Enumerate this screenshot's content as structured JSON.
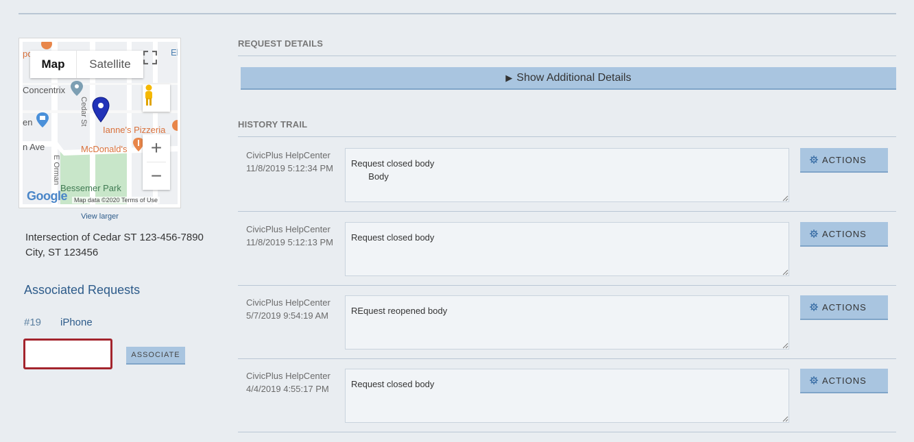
{
  "map": {
    "type_map": "Map",
    "type_satellite": "Satellite",
    "labels": {
      "concentrix": "Concentrix",
      "cedar_st": "Cedar St",
      "pizzeria": "Ianne's Pizzeria",
      "mcdonalds": "McDonald's",
      "park": "Bessemer Park",
      "orman": "E Orman",
      "ave": "n Ave",
      "en": "en",
      "po": "po",
      "el": "El"
    },
    "google": "Google",
    "attribution": "Map data ©2020  Terms of Use",
    "zoom_in": "+",
    "zoom_out": "−",
    "view_larger": "View larger"
  },
  "address": {
    "line1": "Intersection of Cedar ST 123-456-7890",
    "line2": "City, ST 123456"
  },
  "associated": {
    "title": "Associated Requests",
    "items": [
      {
        "number": "#19",
        "label": "iPhone"
      }
    ],
    "input_value": "",
    "button": "ASSOCIATE"
  },
  "request_details": {
    "title": "REQUEST DETAILS",
    "toggle_arrow": "▶",
    "toggle_label": "Show Additional Details"
  },
  "history": {
    "title": "HISTORY TRAIL",
    "actions_label": "ACTIONS",
    "entries": [
      {
        "author": "CivicPlus HelpCenter",
        "timestamp": "11/8/2019 5:12:34 PM",
        "body": "Request closed body\n       Body"
      },
      {
        "author": "CivicPlus HelpCenter",
        "timestamp": "11/8/2019 5:12:13 PM",
        "body": "Request closed body"
      },
      {
        "author": "CivicPlus HelpCenter",
        "timestamp": "5/7/2019 9:54:19 AM",
        "body": "REquest reopened body"
      },
      {
        "author": "CivicPlus HelpCenter",
        "timestamp": "4/4/2019 4:55:17 PM",
        "body": "Request closed body"
      }
    ]
  },
  "colors": {
    "accent_button": "#a9c5e0",
    "link": "#2d5b8a",
    "input_border": "#a3242d",
    "page_bg": "#e9edf1"
  }
}
